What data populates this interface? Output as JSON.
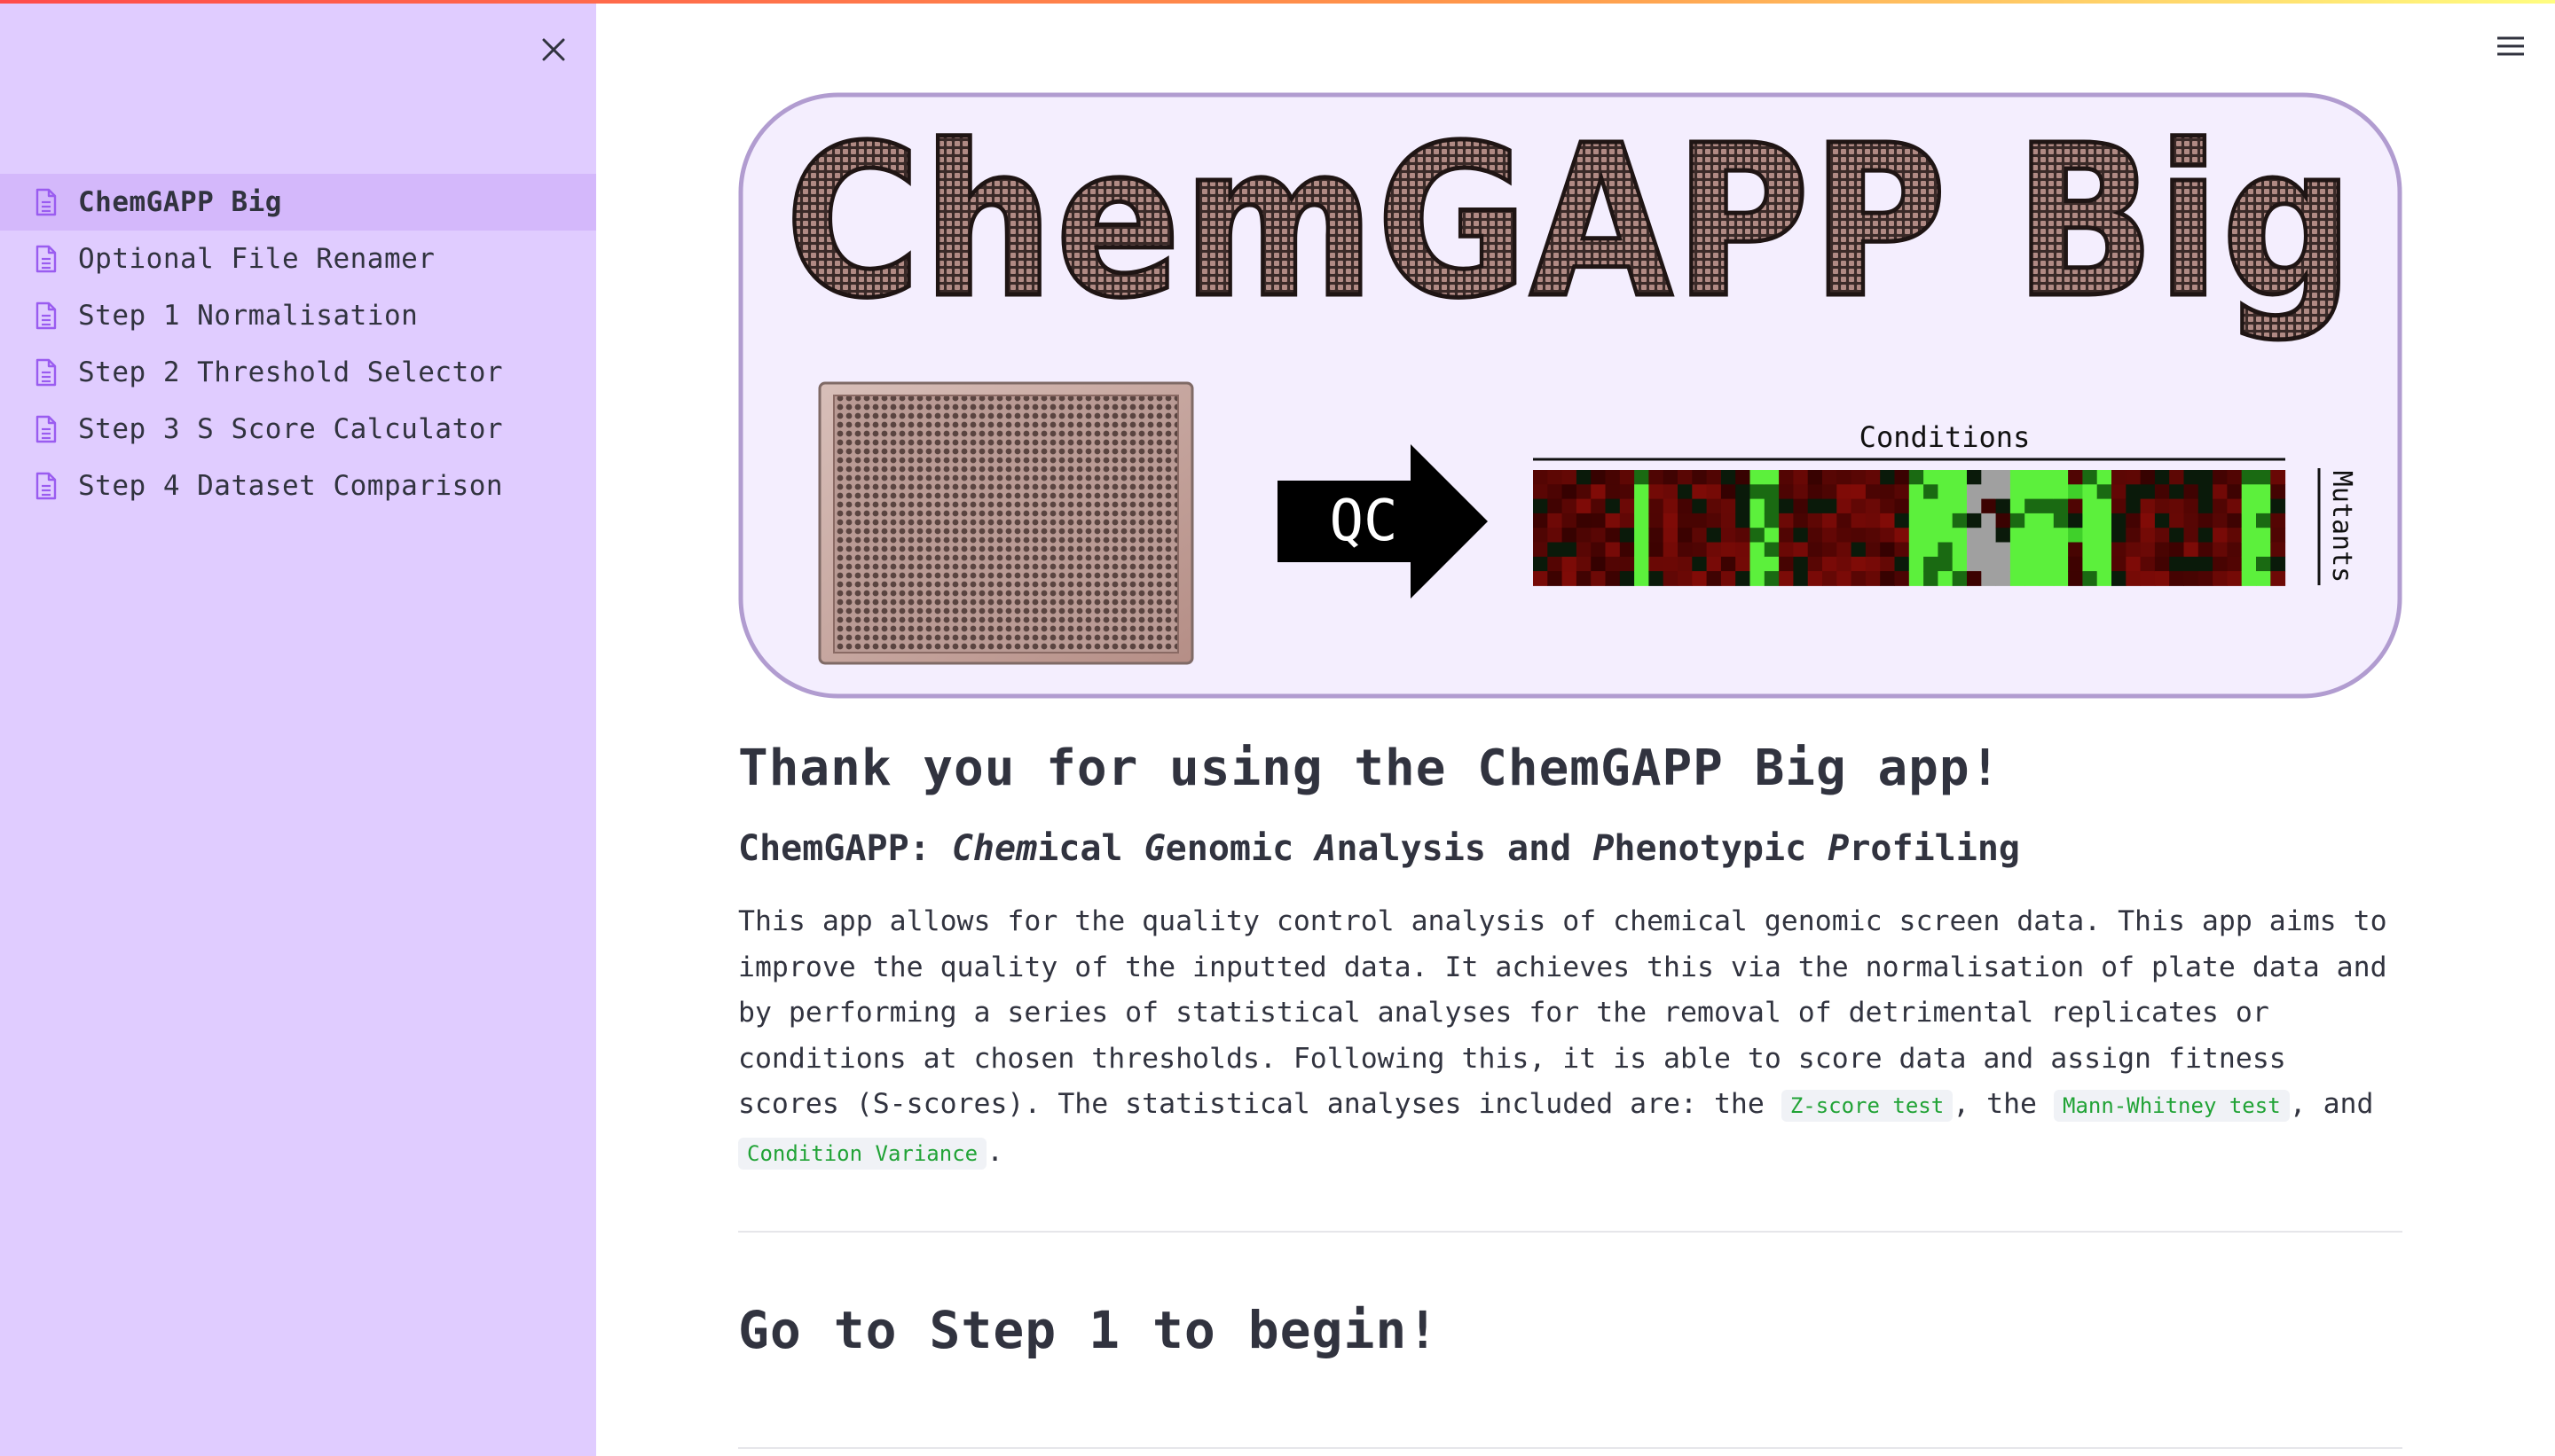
{
  "sidebar": {
    "items": [
      {
        "label": "ChemGAPP Big",
        "active": true
      },
      {
        "label": "Optional File Renamer",
        "active": false
      },
      {
        "label": "Step 1 Normalisation",
        "active": false
      },
      {
        "label": "Step 2 Threshold Selector",
        "active": false
      },
      {
        "label": "Step 3 S Score Calculator",
        "active": false
      },
      {
        "label": "Step 4 Dataset Comparison",
        "active": false
      }
    ]
  },
  "banner": {
    "title": "ChemGAPP Big",
    "arrow_label": "QC",
    "conditions_label": "Conditions",
    "mutants_label": "Mutants"
  },
  "main": {
    "heading": "Thank you for using the ChemGAPP Big app!",
    "subtitle": {
      "prefix": "ChemGAPP: ",
      "p1_i": "Chem",
      "p1": "ical ",
      "p2_i": "G",
      "p2": "enomic ",
      "p3_i": "A",
      "p3": "nalysis and ",
      "p4_i": "P",
      "p4": "henotypic ",
      "p5_i": "P",
      "p5": "rofiling"
    },
    "description": "This app allows for the quality control analysis of chemical genomic screen data. This app aims to improve the quality of the inputted data. It achieves this via the normalisation of plate data and by performing a series of statistical analyses for the removal of detrimental replicates or conditions at chosen thresholds. Following this, it is able to score data and assign fitness scores (S-scores). The statistical analyses included are: the ",
    "code1": "Z-score test",
    "sep1": ", the ",
    "code2": "Mann-Whitney test",
    "sep2": ", and ",
    "code3": "Condition Variance",
    "end": ".",
    "go_heading": "Go to Step 1 to begin!"
  },
  "colors": {
    "sidebar_bg": "#e0ccff",
    "active_item_bg": "#d4b8fb",
    "icon_purple": "#9a5cf0",
    "code_green": "#21a336",
    "banner_bg": "#f4eefe",
    "banner_border": "#b19cd0"
  },
  "icons": [
    "close-icon",
    "document-icon",
    "hamburger-menu-icon"
  ]
}
